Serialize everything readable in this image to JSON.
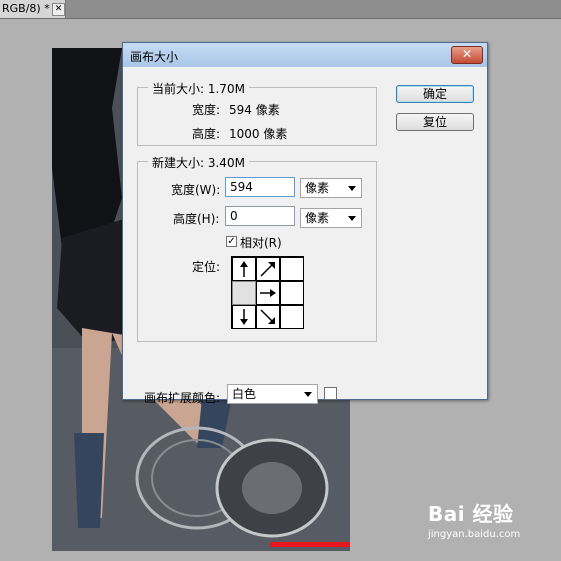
{
  "document_tab": {
    "title": "RGB/8) *",
    "close_label": "✕"
  },
  "dialog": {
    "title": "画布大小",
    "close_label": "✕",
    "ok_button": "确定",
    "reset_button": "复位",
    "current_size": {
      "title": "当前大小: 1.70M",
      "width_label": "宽度:",
      "width_value": "594 像素",
      "height_label": "高度:",
      "height_value": "1000 像素"
    },
    "new_size": {
      "title": "新建大小: 3.40M",
      "width_label": "宽度(W):",
      "width_value": "594",
      "width_unit": "像素",
      "height_label": "高度(H):",
      "height_value": "0",
      "height_unit": "像素",
      "relative_label": "相对(R)",
      "relative_checked": true,
      "anchor_label": "定位:",
      "anchor_selected": "middle-left"
    },
    "extension_color_label": "画布扩展颜色:",
    "extension_color_value": "白色",
    "extension_color_swatch": "#ffffff"
  },
  "watermark": {
    "logo": "Bai 经验",
    "url": "jingyan.baidu.com"
  },
  "colors": {
    "titlebar": "#b8d1ee",
    "close_button": "#c44a33",
    "dialog_bg": "#f0f0f0",
    "workspace": "#b1b1b1",
    "red_selection": "#e8171d"
  }
}
